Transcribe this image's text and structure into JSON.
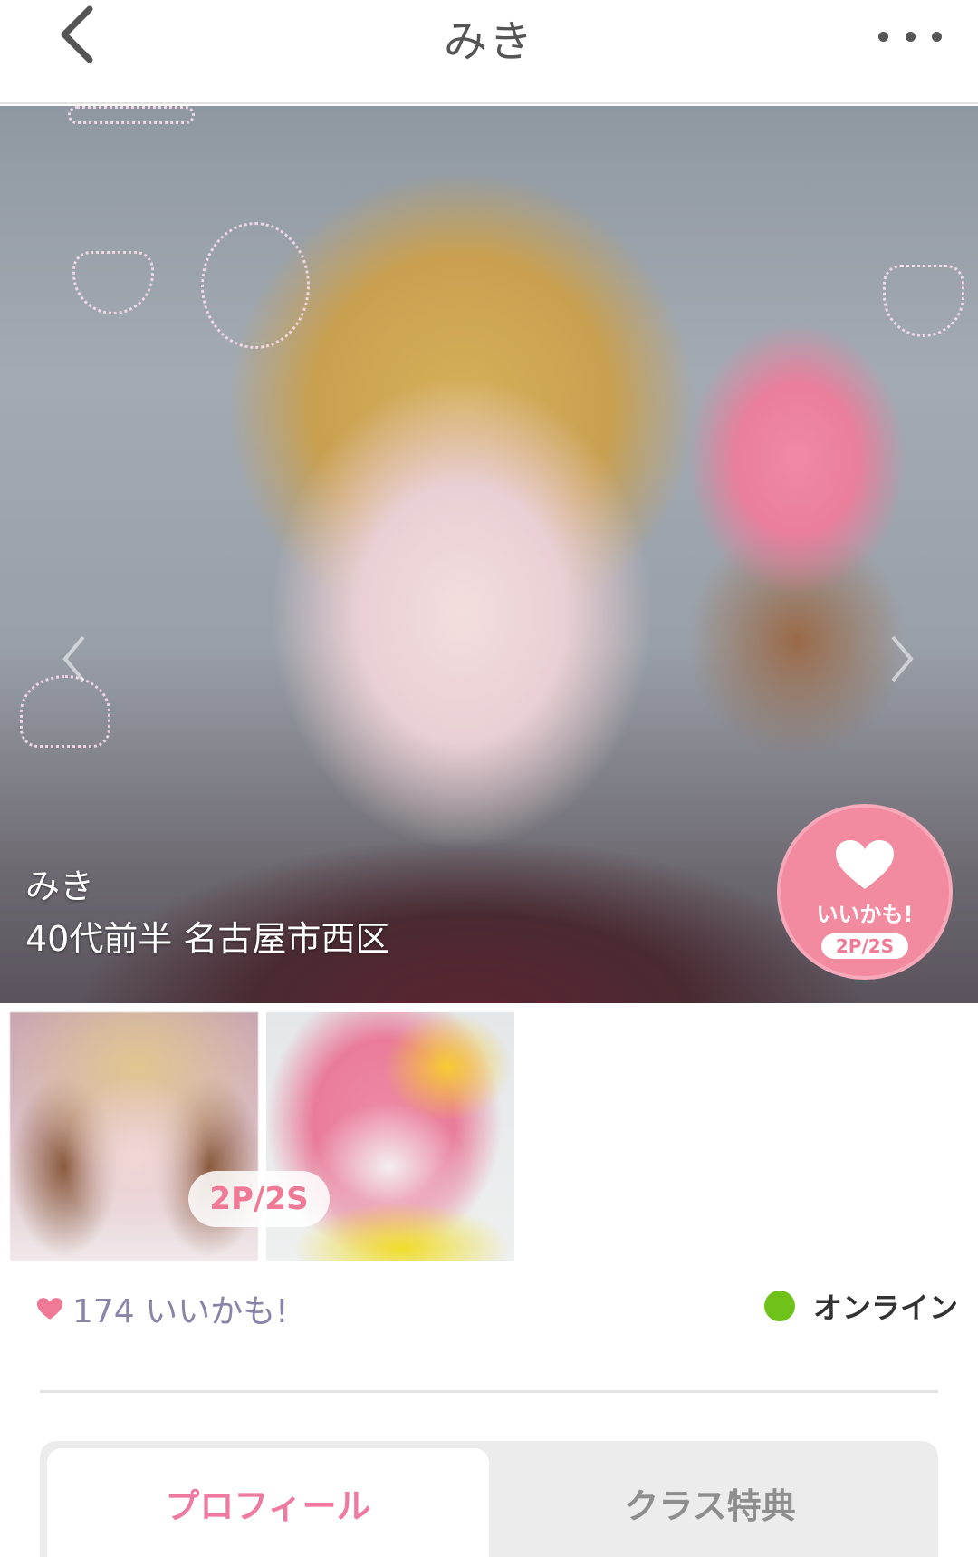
{
  "header": {
    "title": "みき"
  },
  "hero": {
    "name": "みき",
    "info": "40代前半 名古屋市西区",
    "like_button": {
      "label": "いいかも!",
      "cost": "2P/2S"
    }
  },
  "thumbnails": {
    "lock_cost": "2P/2S"
  },
  "stats": {
    "likes": "174 いいかも!",
    "status": "オンライン"
  },
  "tabs": [
    {
      "label": "プロフィール",
      "active": true
    },
    {
      "label": "クラス特典",
      "active": false
    }
  ],
  "colors": {
    "accent_pink": "#f07a95",
    "online_green": "#6ec21a",
    "likes_text": "#8a84a8"
  }
}
